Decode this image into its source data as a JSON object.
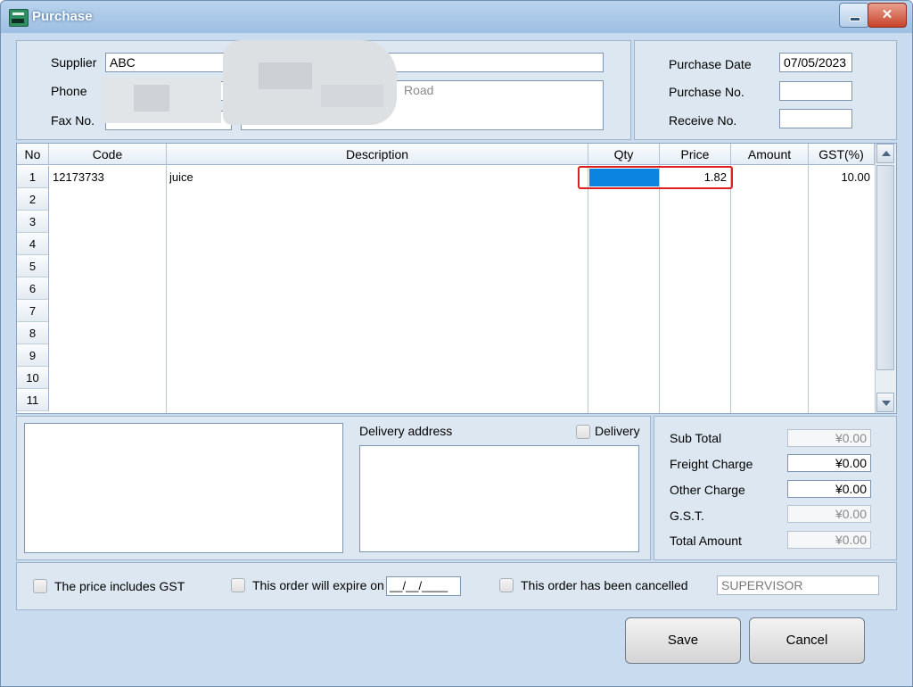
{
  "window": {
    "title": "Purchase"
  },
  "header": {
    "supplier_label": "Supplier",
    "supplier_value": "ABC",
    "phone_label": "Phone",
    "fax_label": "Fax No.",
    "address_partial": "Road",
    "purchase_date_label": "Purchase Date",
    "purchase_date_value": "07/05/2023",
    "purchase_no_label": "Purchase No.",
    "purchase_no_value": "",
    "receive_no_label": "Receive No.",
    "receive_no_value": ""
  },
  "grid": {
    "columns": [
      "No",
      "Code",
      "Description",
      "Qty",
      "Price",
      "Amount",
      "GST(%)"
    ],
    "row_numbers": [
      "1",
      "2",
      "3",
      "4",
      "5",
      "6",
      "7",
      "8",
      "9",
      "10",
      "11"
    ],
    "rows": [
      {
        "no": "1",
        "code": "12173733",
        "description": "juice",
        "qty": "",
        "price": "1.82",
        "amount": "",
        "gst": "10.00"
      }
    ]
  },
  "footer": {
    "delivery_address_label": "Delivery address",
    "delivery_checkbox_label": "Delivery",
    "totals": [
      {
        "label": "Sub Total",
        "value": "¥0.00"
      },
      {
        "label": "Freight Charge",
        "value": "¥0.00"
      },
      {
        "label": "Other Charge",
        "value": "¥0.00"
      },
      {
        "label": "G.S.T.",
        "value": "¥0.00"
      },
      {
        "label": "Total Amount",
        "value": "¥0.00"
      }
    ],
    "price_includes_gst_label": "The price includes GST",
    "expire_label": "This order will expire on",
    "expire_value": "__/__/____",
    "cancelled_label": "This order has been cancelled",
    "user_value": "SUPERVISOR"
  },
  "buttons": {
    "save": "Save",
    "cancel": "Cancel"
  },
  "colors": {
    "selection": "#0a84e0",
    "highlight_box": "#e02020",
    "window_bg": "#dce7f1"
  }
}
